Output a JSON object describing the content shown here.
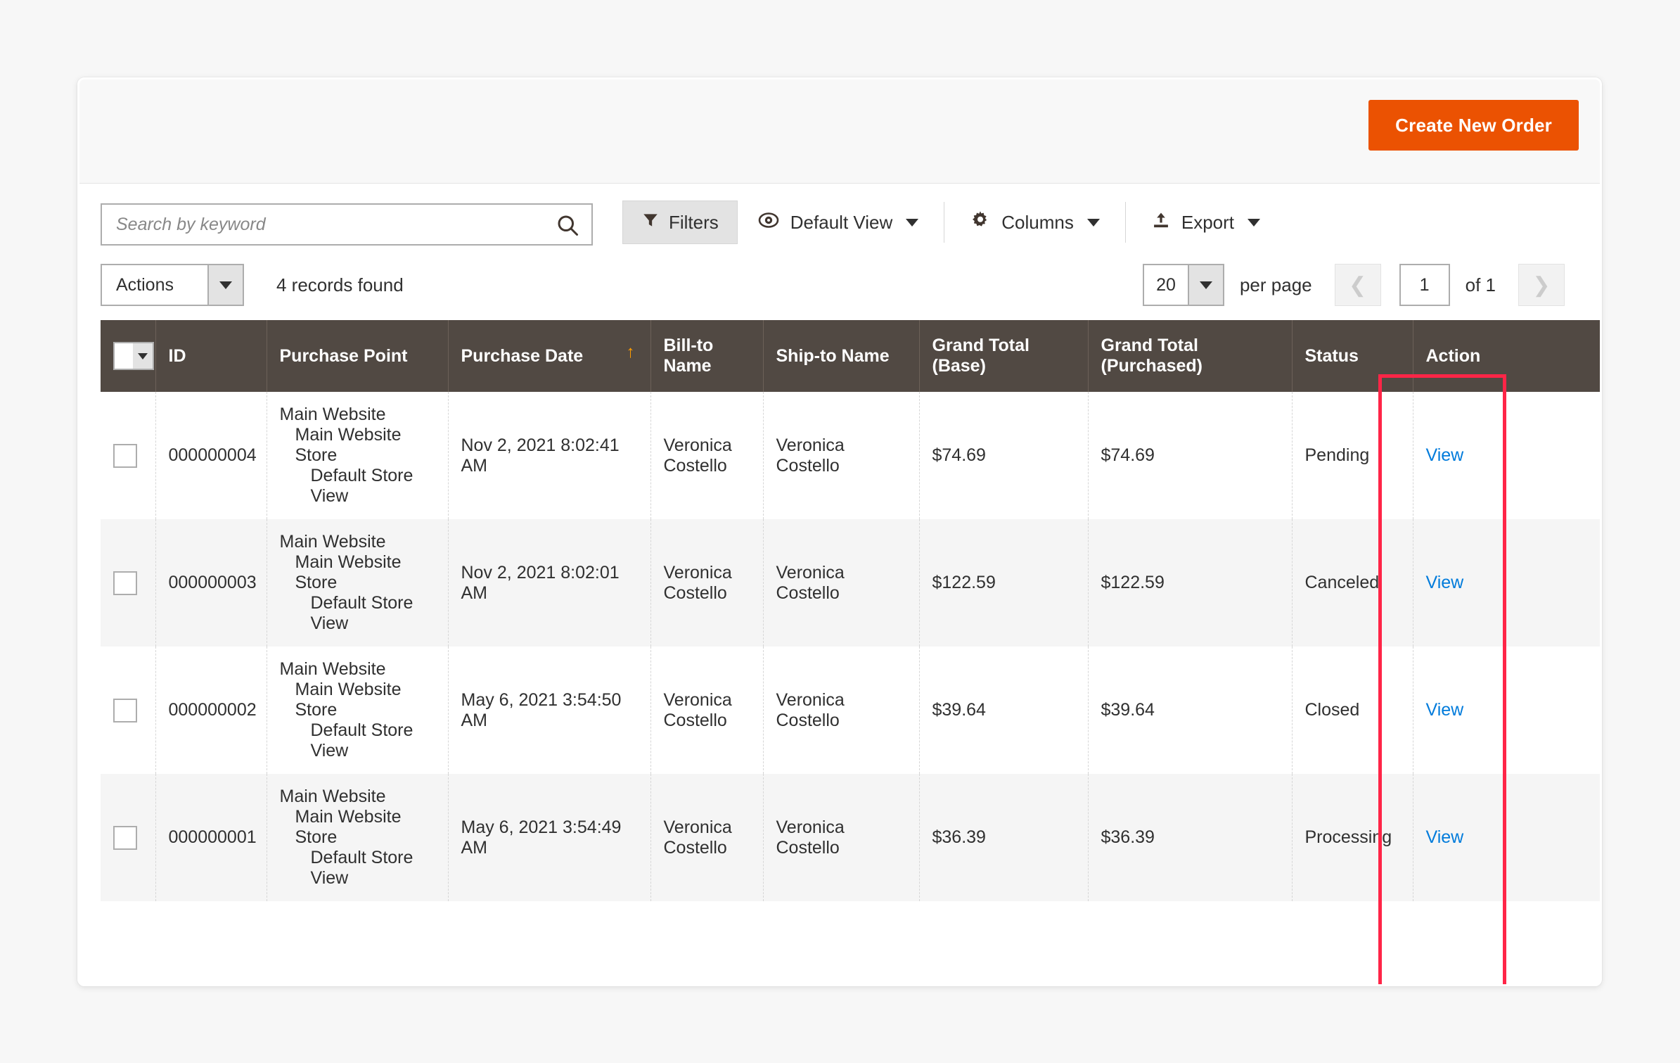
{
  "header": {
    "create_order_label": "Create New Order"
  },
  "search": {
    "placeholder": "Search by keyword",
    "value": "",
    "icon": "search-icon"
  },
  "toolbar": {
    "filters_label": "Filters",
    "filters_icon": "funnel-icon",
    "view_label": "Default View",
    "view_icon": "eye-icon",
    "columns_label": "Columns",
    "columns_icon": "gear-icon",
    "export_label": "Export",
    "export_icon": "upload-icon"
  },
  "actions": {
    "label": "Actions",
    "records_found": "4 records found"
  },
  "pager": {
    "per_page_value": "20",
    "per_page_label": "per page",
    "prev_icon": "chevron-left-icon",
    "next_icon": "chevron-right-icon",
    "page_value": "1",
    "of_label": "of 1"
  },
  "table": {
    "columns": [
      {
        "key": "checkbox",
        "label": ""
      },
      {
        "key": "id",
        "label": "ID"
      },
      {
        "key": "purchase_point",
        "label": "Purchase Point"
      },
      {
        "key": "purchase_date",
        "label": "Purchase Date",
        "sorted": "asc"
      },
      {
        "key": "bill_to",
        "label": "Bill-to Name"
      },
      {
        "key": "ship_to",
        "label": "Ship-to Name"
      },
      {
        "key": "grand_total_base",
        "label": "Grand Total (Base)"
      },
      {
        "key": "grand_total_purchased",
        "label": "Grand Total (Purchased)"
      },
      {
        "key": "status",
        "label": "Status"
      },
      {
        "key": "action",
        "label": "Action"
      }
    ],
    "rows": [
      {
        "id": "000000004",
        "pp1": "Main Website",
        "pp2": "Main Website Store",
        "pp3": "Default Store View",
        "purchase_date": "Nov 2, 2021 8:02:41 AM",
        "bill_to": "Veronica Costello",
        "ship_to": "Veronica Costello",
        "grand_total_base": "$74.69",
        "grand_total_purchased": "$74.69",
        "status": "Pending",
        "action": "View"
      },
      {
        "id": "000000003",
        "pp1": "Main Website",
        "pp2": "Main Website Store",
        "pp3": "Default Store View",
        "purchase_date": "Nov 2, 2021 8:02:01 AM",
        "bill_to": "Veronica Costello",
        "ship_to": "Veronica Costello",
        "grand_total_base": "$122.59",
        "grand_total_purchased": "$122.59",
        "status": "Canceled",
        "action": "View"
      },
      {
        "id": "000000002",
        "pp1": "Main Website",
        "pp2": "Main Website Store",
        "pp3": "Default Store View",
        "purchase_date": "May 6, 2021 3:54:50 AM",
        "bill_to": "Veronica Costello",
        "ship_to": "Veronica Costello",
        "grand_total_base": "$39.64",
        "grand_total_purchased": "$39.64",
        "status": "Closed",
        "action": "View"
      },
      {
        "id": "000000001",
        "pp1": "Main Website",
        "pp2": "Main Website Store",
        "pp3": "Default Store View",
        "purchase_date": "May 6, 2021 3:54:49 AM",
        "bill_to": "Veronica Costello",
        "ship_to": "Veronica Costello",
        "grand_total_base": "$36.39",
        "grand_total_purchased": "$36.39",
        "status": "Processing",
        "action": "View"
      }
    ]
  },
  "annotation": {
    "highlight_target": "status-column",
    "highlight_color": "#ff2547"
  },
  "colors": {
    "accent_orange": "#eb5202",
    "header_brown": "#514943",
    "link_blue": "#007bdb",
    "sort_arrow": "#ff9c00"
  }
}
